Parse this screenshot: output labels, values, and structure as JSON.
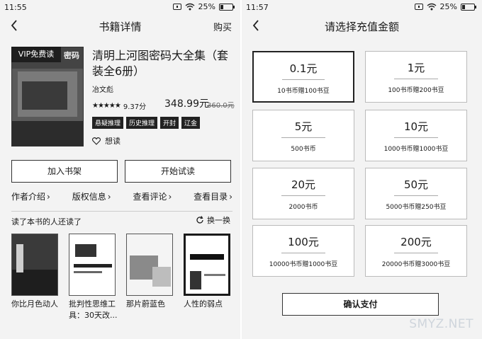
{
  "left": {
    "status": {
      "time": "11:55",
      "battery": "25%",
      "battery_level": 0.25
    },
    "header": {
      "title": "书籍详情",
      "buy_label": "购买"
    },
    "book": {
      "vip_badge": "VIP免费读",
      "cover_text": "密码",
      "title": "清明上河图密码大全集（套装全6册）",
      "author": "冶文彪",
      "rating": "9.37分",
      "stars": "★★★★★",
      "price": "348.99元",
      "original_price": "360.0元",
      "tags": [
        "悬疑推理",
        "历史推理",
        "开封",
        "辽金"
      ],
      "want_label": "想读"
    },
    "actions": {
      "add_shelf": "加入书架",
      "start_read": "开始试读"
    },
    "nav": [
      {
        "label": "作者介绍"
      },
      {
        "label": "版权信息"
      },
      {
        "label": "查看评论"
      },
      {
        "label": "查看目录"
      }
    ],
    "others_label": "读了本书的人还读了",
    "refresh_label": "换一换",
    "recommendations": [
      {
        "title": "你比月色动人"
      },
      {
        "title": "批判性思维工具：30天改..."
      },
      {
        "title": "那片蔚蓝色"
      },
      {
        "title": "人性的弱点"
      }
    ]
  },
  "right": {
    "status": {
      "time": "11:57",
      "battery": "25%",
      "battery_level": 0.25
    },
    "header": {
      "title": "请选择充值金额"
    },
    "options": [
      {
        "amount": "0.1元",
        "desc": "10书币赠100书豆",
        "selected": true
      },
      {
        "amount": "1元",
        "desc": "100书币赠200书豆",
        "selected": false
      },
      {
        "amount": "5元",
        "desc": "500书币",
        "selected": false
      },
      {
        "amount": "10元",
        "desc": "1000书币赠1000书豆",
        "selected": false
      },
      {
        "amount": "20元",
        "desc": "2000书币",
        "selected": false
      },
      {
        "amount": "50元",
        "desc": "5000书币赠250书豆",
        "selected": false
      },
      {
        "amount": "100元",
        "desc": "10000书币赠1000书豆",
        "selected": false
      },
      {
        "amount": "200元",
        "desc": "20000书币赠3000书豆",
        "selected": false
      }
    ],
    "confirm_label": "确认支付"
  },
  "watermark": "SMYZ.NET"
}
